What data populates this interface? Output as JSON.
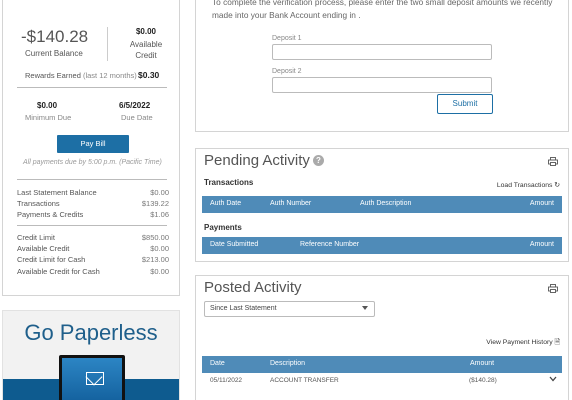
{
  "account": {
    "current_balance": "-$140.28",
    "current_balance_label": "Current Balance",
    "available_credit": "$0.00",
    "available_credit_label": "Available Credit",
    "rewards_label": "Rewards Earned",
    "rewards_period": "(last 12 months)",
    "rewards_value": "$0.30",
    "minimum_due": "$0.00",
    "minimum_due_label": "Minimum Due",
    "due_date": "6/5/2022",
    "due_date_label": "Due Date",
    "pay_bill_label": "Pay Bill",
    "payment_note": "All payments due by 5:00 p.m. (Pacific Time)",
    "statement_items": [
      {
        "label": "Last Statement Balance",
        "value": "$0.00"
      },
      {
        "label": "Transactions",
        "value": "$139.22"
      },
      {
        "label": "Payments & Credits",
        "value": "$1.06"
      }
    ],
    "credit_items": [
      {
        "label": "Credit Limit",
        "value": "$850.00"
      },
      {
        "label": "Available Credit",
        "value": "$0.00"
      },
      {
        "label": "Credit Limit for Cash",
        "value": "$213.00"
      },
      {
        "label": "Available Credit for Cash",
        "value": "$0.00"
      }
    ]
  },
  "paperless": {
    "title": "Go Paperless"
  },
  "verification": {
    "instructions": "To complete the verification process, please enter the two small deposit amounts we recently made into your Bank Account ending in .",
    "deposit1_label": "Deposit 1",
    "deposit1_value": "",
    "deposit2_label": "Deposit 2",
    "deposit2_value": "",
    "submit_label": "Submit"
  },
  "pending": {
    "title": "Pending Activity",
    "help_icon": "question-circle-icon",
    "transactions_heading": "Transactions",
    "load_transactions_label": "Load Transactions",
    "transactions_columns": [
      "Auth Date",
      "Auth Number",
      "Auth Description",
      "Amount"
    ],
    "payments_heading": "Payments",
    "payments_columns": [
      "Date Submitted",
      "Reference Number",
      "Amount"
    ]
  },
  "posted": {
    "title": "Posted Activity",
    "filter_selected": "Since Last Statement",
    "view_history_label": "View Payment History",
    "columns": [
      "Date",
      "Description",
      "Amount"
    ],
    "rows": [
      {
        "date": "05/11/2022",
        "description": "ACCOUNT TRANSFER",
        "amount": "($140.28)"
      }
    ]
  },
  "colors": {
    "accent": "#1d6fa5",
    "table_header": "#4f8bb8",
    "paperless_title": "#1f5f8b"
  }
}
